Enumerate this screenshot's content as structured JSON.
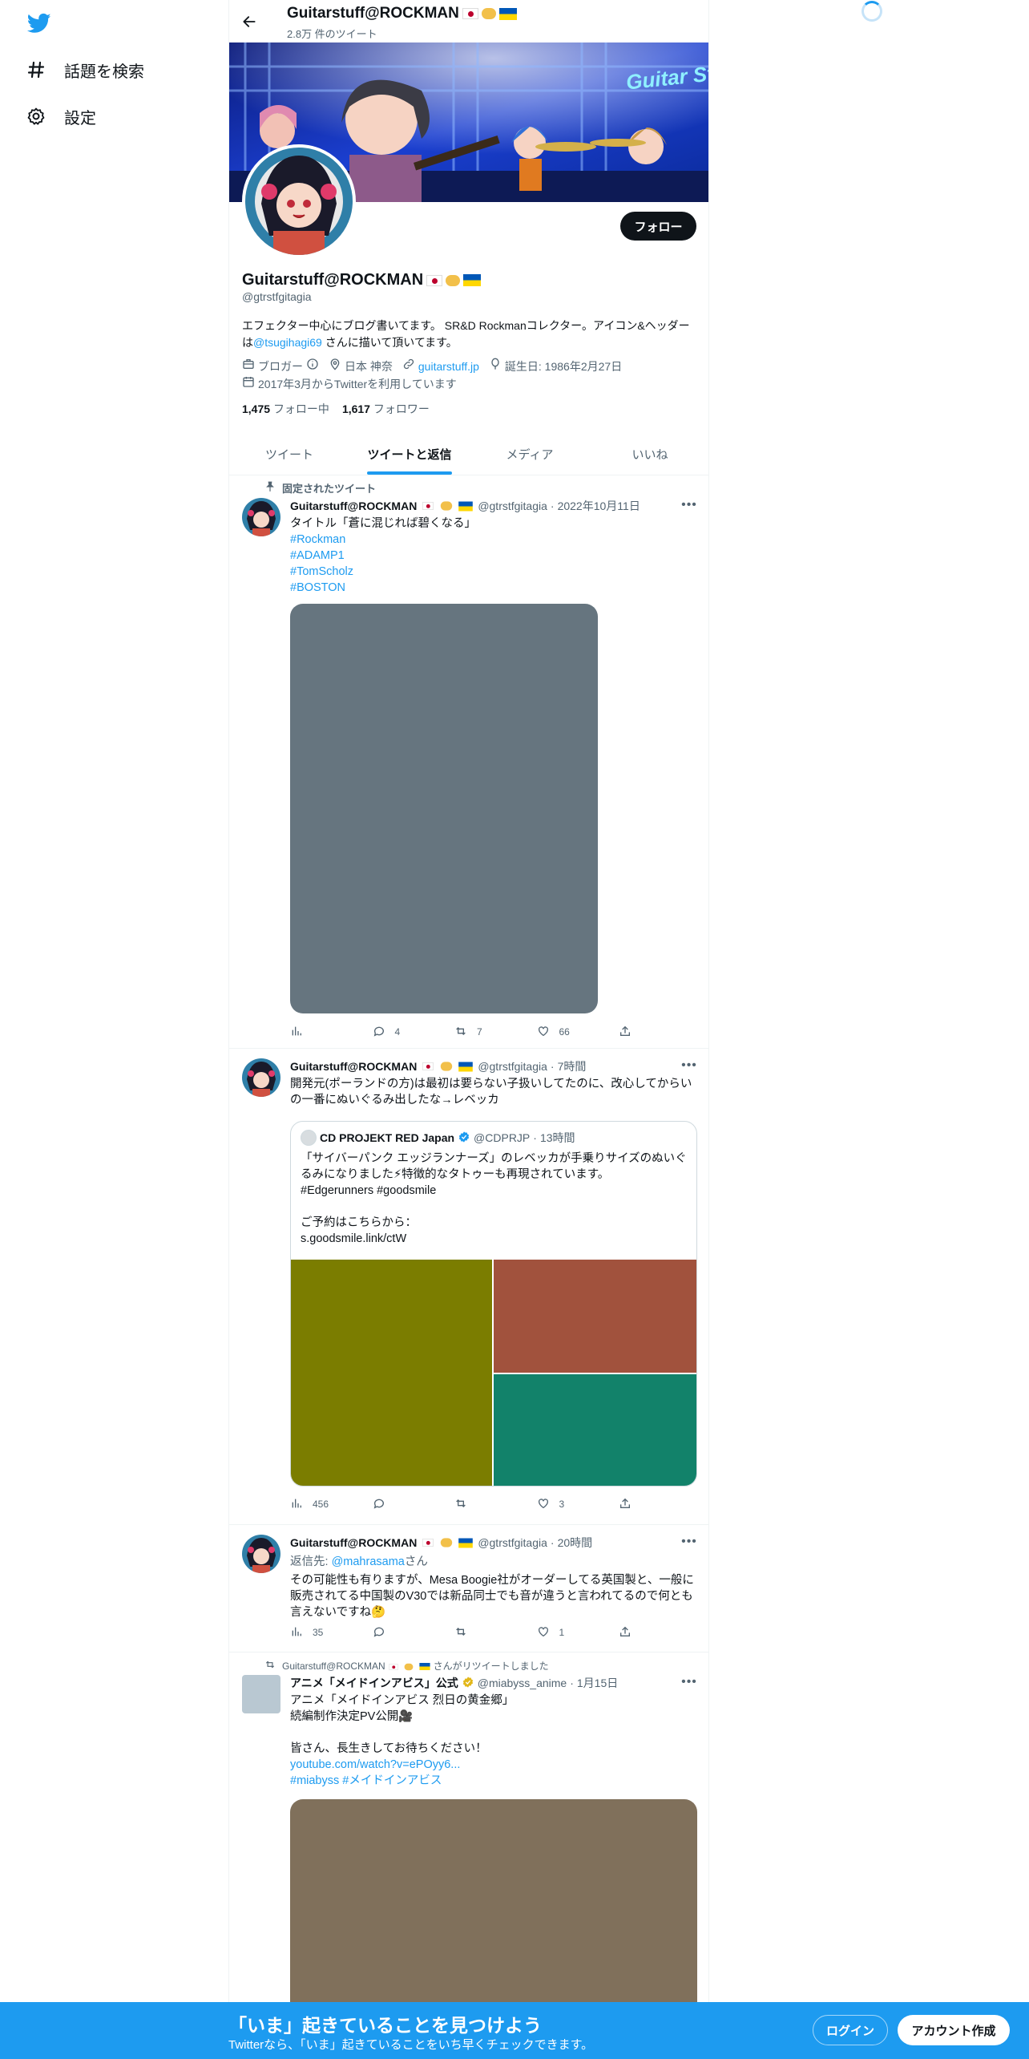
{
  "sidebar": {
    "logo": "twitter-bird-icon",
    "items": [
      {
        "icon": "hash-icon",
        "label": "話題を検索"
      },
      {
        "icon": "gear-icon",
        "label": "設定"
      }
    ]
  },
  "header": {
    "title": "Guitarstuff@ROCKMAN",
    "subtitle": "2.8万 件のツイート"
  },
  "banner": {
    "text": "Guitar Stuff Blog"
  },
  "profile": {
    "follow_label": "フォロー",
    "name": "Guitarstuff@ROCKMAN",
    "handle": "@gtrstfgitagia",
    "bio_prefix": "エフェクター中心にブログ書いてます。 SR&D Rockmanコレクター。アイコン&ヘッダーは",
    "bio_link": "@tsugihagi69",
    "bio_suffix": " さんに描いて頂いてます。",
    "category": "ブロガー",
    "location": "日本 神奈",
    "website": "guitarstuff.jp",
    "birthday": "誕生日: 1986年2月27日",
    "joined": "2017年3月からTwitterを利用しています",
    "following_count": "1,475",
    "following_label": "フォロー中",
    "followers_count": "1,617",
    "followers_label": "フォロワー"
  },
  "tabs": [
    {
      "label": "ツイート",
      "active": false
    },
    {
      "label": "ツイートと返信",
      "active": true
    },
    {
      "label": "メディア",
      "active": false
    },
    {
      "label": "いいね",
      "active": false
    }
  ],
  "tweets": {
    "t1": {
      "pinned_label": "固定されたツイート",
      "name": "Guitarstuff@ROCKMAN",
      "handle": "@gtrstfgitagia",
      "time": "2022年10月11日",
      "text": "タイトル「蒼に混じれば碧くなる」",
      "hashtags": [
        "#Rockman",
        "#ADAMP1",
        "#TomScholz",
        "#BOSTON"
      ],
      "replies": "4",
      "retweets": "7",
      "likes": "66",
      "views": ""
    },
    "t2": {
      "name": "Guitarstuff@ROCKMAN",
      "handle": "@gtrstfgitagia",
      "time": "7時間",
      "text": "開発元(ポーランドの方)は最初は要らない子扱いしてたのに、改心してからいの一番にぬいぐるみ出したな→レベッカ",
      "quote": {
        "name": "CD PROJEKT RED Japan",
        "handle": "@CDPRJP",
        "time": "13時間",
        "text1": "「サイバーパンク エッジランナーズ」のレベッカが手乗りサイズのぬいぐるみになりました⚡特徴的なタトゥーも再現されています。",
        "text2": "#Edgerunners #goodsmile",
        "text3": "ご予約はこちらから：",
        "text4": "s.goodsmile.link/ctW"
      },
      "views": "456",
      "replies": "",
      "retweets": "",
      "likes": "3"
    },
    "t3": {
      "name": "Guitarstuff@ROCKMAN",
      "handle": "@gtrstfgitagia",
      "time": "20時間",
      "reply_prefix": "返信先: ",
      "reply_to": "@mahrasama",
      "reply_suffix": "さん",
      "text": "その可能性も有りますが、Mesa Boogie社がオーダーしてる英国製と、一般に販売されてる中国製のV30では新品同士でも音が違うと言われてるので何とも言えないですね🤔",
      "views": "35",
      "replies": "",
      "retweets": "",
      "likes": "1"
    },
    "t4": {
      "retweet_label": "Guitarstuff@ROCKMAN",
      "retweet_suffix": "さんがリツイートしました",
      "name": "アニメ「メイドインアビス」公式",
      "handle": "@miabyss_anime",
      "time": "1月15日",
      "line1": "アニメ「メイドインアビス 烈日の黄金郷」",
      "line2": "続編制作決定PV公開🎥",
      "line3": "皆さん、長生きしてお待ちください！",
      "link": "youtube.com/watch?v=ePOyy6...",
      "tags": "#miabyss #メイドインアビス"
    }
  },
  "bottom_bar": {
    "title": "「いま」起きていることを見つけよう",
    "subtitle": "Twitterなら、「いま」起きていることをいち早くチェックできます。",
    "login_label": "ログイン",
    "signup_label": "アカウント作成"
  },
  "colors": {
    "accent": "#1d9bf0",
    "text": "#0f1419",
    "muted": "#536471"
  }
}
